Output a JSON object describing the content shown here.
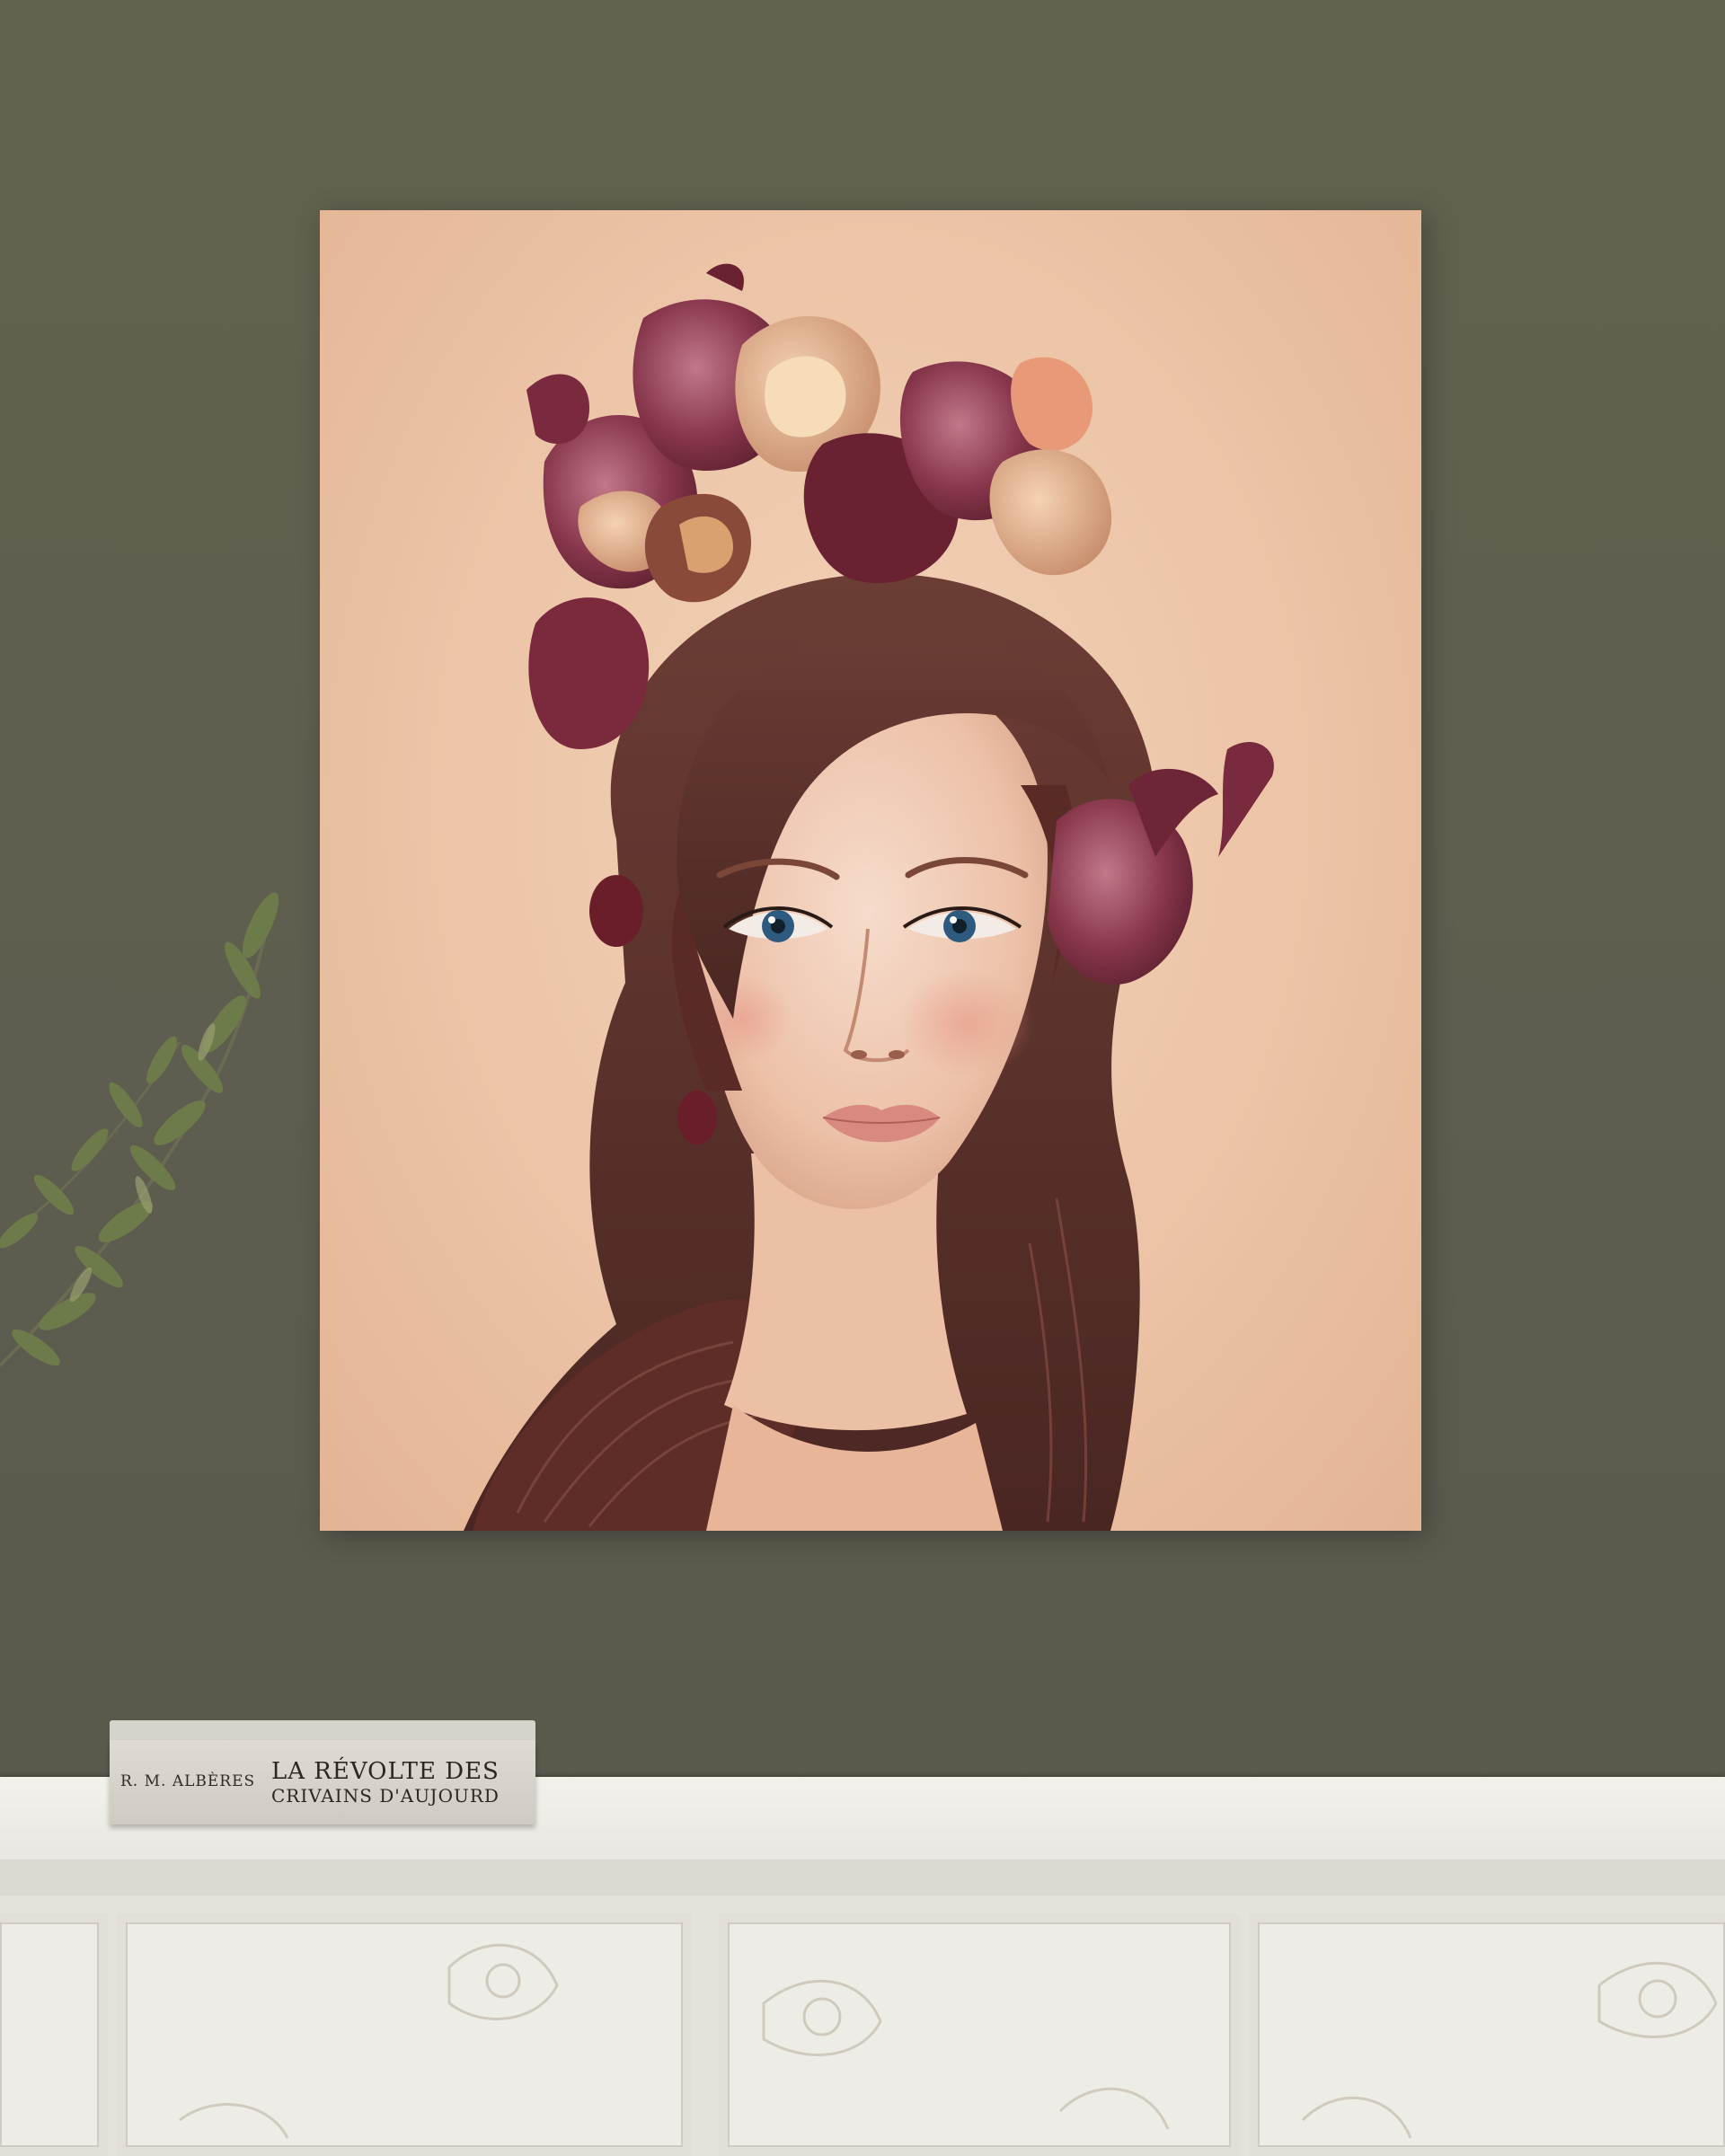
{
  "scene": {
    "wall_color": "#5f5e50",
    "canvas_background": "#ecc4a7",
    "sideboard_color": "#eeece7"
  },
  "book": {
    "author": "R. M. ALBÈRES",
    "title_line1": "LA RÉVOLTE DES",
    "title_line2": "CRIVAINS D'AUJOURD"
  },
  "painting": {
    "subject": "portrait-woman-with-flower-crown",
    "hair_color": "#5a2f2a",
    "flower_color": "#7a3040",
    "skin_color": "#f2d2bf",
    "eye_color": "#2f5a80",
    "lip_color": "#d98a80"
  },
  "plant": {
    "leaf_color": "#6d7a4a"
  }
}
